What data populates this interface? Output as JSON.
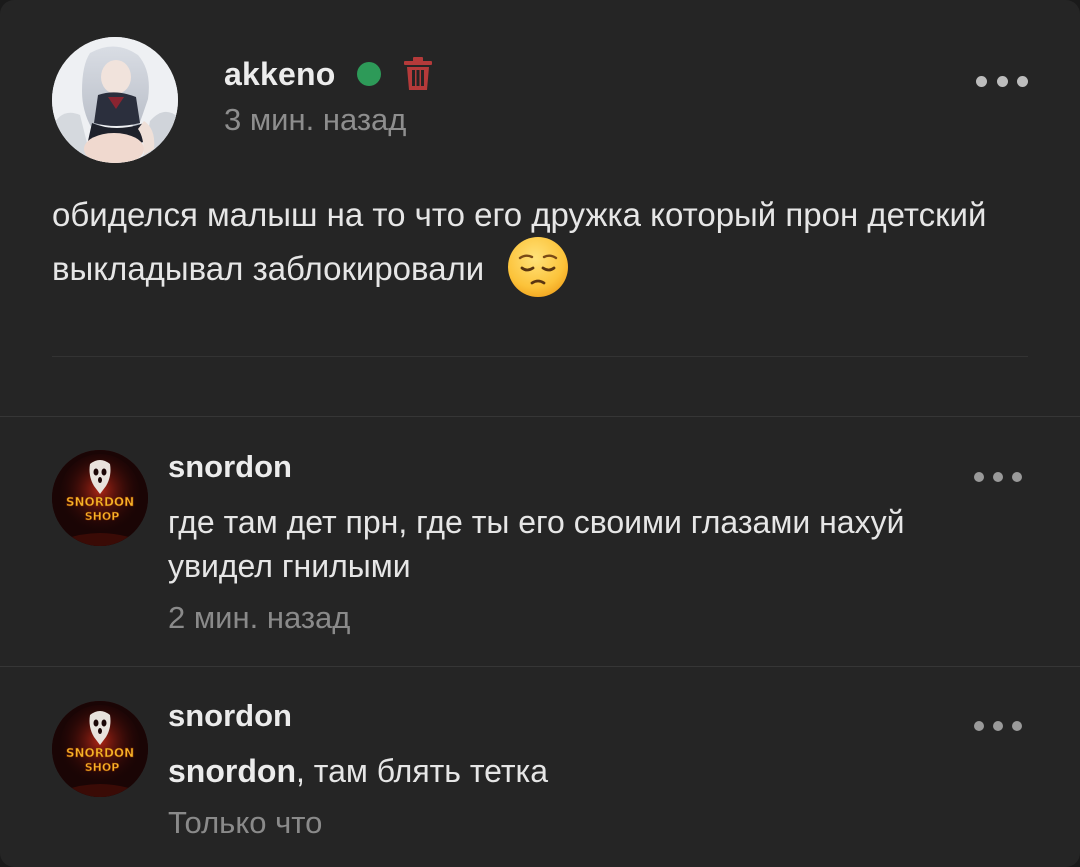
{
  "post": {
    "author": "akkeno",
    "time": "3 мин. назад",
    "text": "обиделся малыш на то что его дружка который прон детский выкладывал заблокировали",
    "emoji": "pensive-face-emoji",
    "online_color": "#2d9a58",
    "delete_icon_color": "#b43a3a"
  },
  "comments": [
    {
      "author": "snordon",
      "avatar_badge_line1": "SNORDON",
      "avatar_badge_line2": "SHOP",
      "text": "где там дет прн, где ты его своими глазами нахуй увидел гнилыми",
      "time": "2 мин. назад"
    },
    {
      "author": "snordon",
      "avatar_badge_line1": "SNORDON",
      "avatar_badge_line2": "SHOP",
      "mention": "snordon",
      "text": ", там блять тетка",
      "time": "Только что"
    }
  ]
}
